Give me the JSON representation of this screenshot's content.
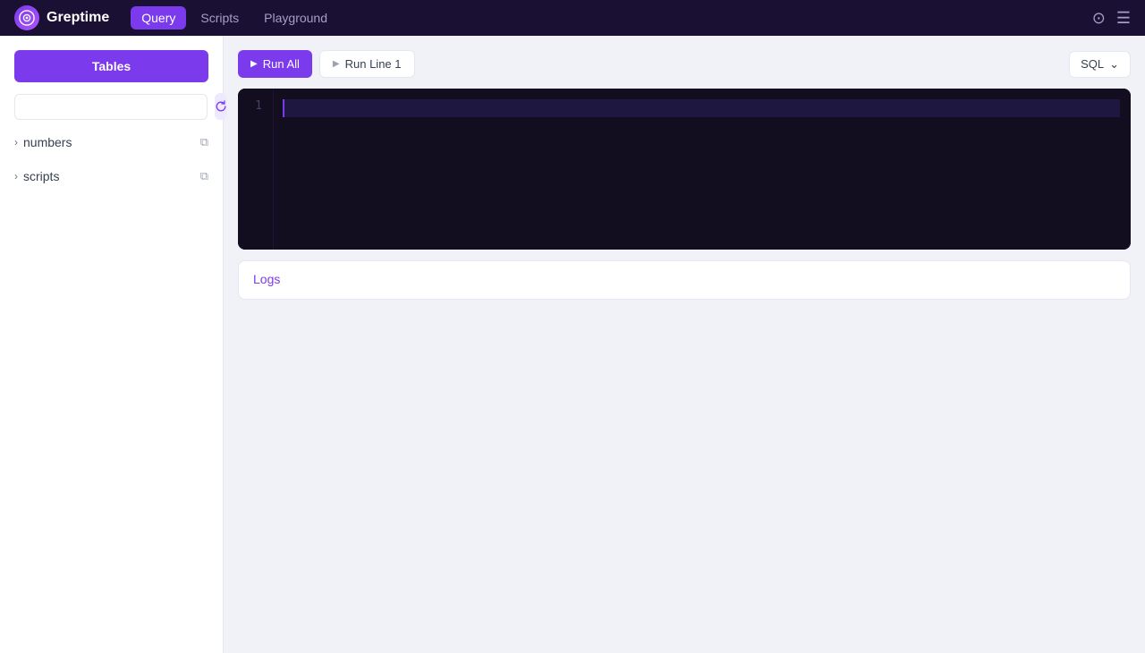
{
  "header": {
    "logo_text": "Greptime",
    "logo_symbol": "G",
    "nav": [
      {
        "label": "Query",
        "active": true
      },
      {
        "label": "Scripts",
        "active": false
      },
      {
        "label": "Playground",
        "active": false
      }
    ],
    "icons": [
      "⊙",
      "☰"
    ]
  },
  "sidebar": {
    "tables_button": "Tables",
    "search_placeholder": "",
    "tree_items": [
      {
        "label": "numbers",
        "expanded": false
      },
      {
        "label": "scripts",
        "expanded": false
      }
    ]
  },
  "toolbar": {
    "run_all_label": "Run All",
    "run_line_label": "Run Line 1",
    "sql_label": "SQL"
  },
  "editor": {
    "line_numbers": [
      1
    ],
    "content": ""
  },
  "logs": {
    "title": "Logs"
  }
}
